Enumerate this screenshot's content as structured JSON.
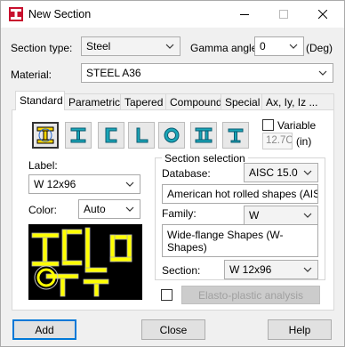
{
  "window": {
    "title": "New Section"
  },
  "header": {
    "section_type_label": "Section type:",
    "section_type_value": "Steel",
    "gamma_label": "Gamma angle:",
    "gamma_value": "0",
    "gamma_unit": "(Deg)",
    "material_label": "Material:",
    "material_value": "STEEL A36"
  },
  "tabs": [
    "Standard",
    "Parametric",
    "Tapered",
    "Compound",
    "Special",
    "Ax, Iy, Iz ..."
  ],
  "standard": {
    "shape_icons": [
      "i-section-icon",
      "i-section-alt-icon",
      "channel-icon",
      "angle-icon",
      "pipe-icon",
      "double-i-icon",
      "t-section-icon"
    ],
    "variable_label": "Variable",
    "variable_value": "12.7C",
    "variable_unit": "(in)",
    "label_caption": "Label:",
    "label_value": "W 12x96",
    "color_caption": "Color:",
    "color_value": "Auto",
    "group_title": "Section selection",
    "database_label": "Database:",
    "database_value": "AISC 15.0",
    "database_desc": "American hot rolled shapes (AISC E",
    "family_label": "Family:",
    "family_value": "W",
    "family_desc": "Wide-flange Shapes (W-Shapes)",
    "section_label": "Section:",
    "section_value": "W 12x96",
    "elasto_button": "Elasto-plastic analysis"
  },
  "footer": {
    "add": "Add",
    "close": "Close",
    "help": "Help"
  },
  "colors": {
    "accent": "#0078d7",
    "preview_bg": "#000000",
    "preview_shape": "#ffff00",
    "brand_red": "#c8102e"
  }
}
